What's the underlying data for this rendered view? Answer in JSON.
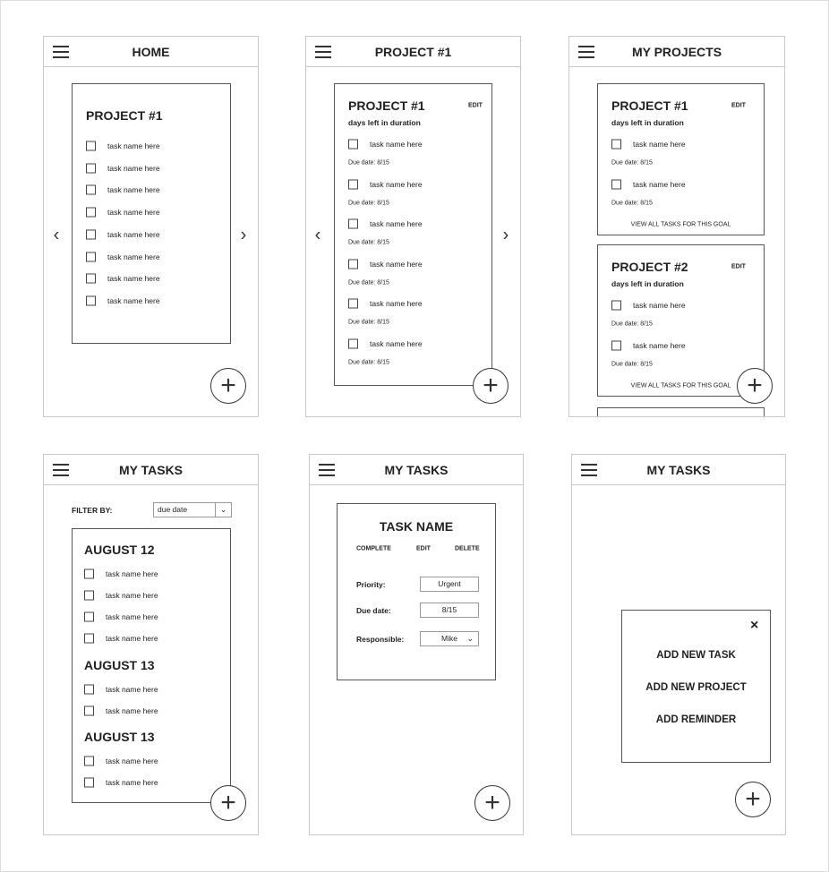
{
  "screens": [
    {
      "title": "HOME",
      "project": "PROJECT #1",
      "tasks": [
        "task name here",
        "task name here",
        "task name here",
        "task name here",
        "task name here",
        "task name here",
        "task name here",
        "task name here"
      ]
    },
    {
      "title": "PROJECT #1",
      "project": "PROJECT #1",
      "edit": "EDIT",
      "duration": "days left in duration",
      "tasks": [
        {
          "name": "task name here",
          "due": "Due date: 8/15"
        },
        {
          "name": "task name here",
          "due": "Due date: 8/15"
        },
        {
          "name": "task name here",
          "due": "Due date: 8/15"
        },
        {
          "name": "task name here",
          "due": "Due date: 8/15"
        },
        {
          "name": "task name here",
          "due": "Due date: 8/15"
        },
        {
          "name": "task name here",
          "due": "Due date: 8/15"
        }
      ]
    },
    {
      "title": "MY PROJECTS",
      "projects": [
        {
          "title": "PROJECT #1",
          "edit": "EDIT",
          "duration": "days left in duration",
          "tasks": [
            {
              "name": "task name here",
              "due": "Due date: 8/15"
            },
            {
              "name": "task name here",
              "due": "Due date: 8/15"
            }
          ],
          "view_all": "VIEW ALL TASKS FOR THIS GOAL"
        },
        {
          "title": "PROJECT #2",
          "edit": "EDIT",
          "duration": "days left in duration",
          "tasks": [
            {
              "name": "task name here",
              "due": "Due date: 8/15"
            },
            {
              "name": "task name here",
              "due": "Due date: 8/15"
            }
          ],
          "view_all": "VIEW ALL TASKS FOR THIS GOAL"
        }
      ]
    },
    {
      "title": "MY TASKS",
      "filter_label": "FILTER BY:",
      "filter_value": "due date",
      "groups": [
        {
          "heading": "AUGUST 12",
          "tasks": [
            "task name here",
            "task name here",
            "task name here",
            "task name here"
          ]
        },
        {
          "heading": "AUGUST 13",
          "tasks": [
            "task name here",
            "task name here"
          ]
        },
        {
          "heading": "AUGUST 13",
          "tasks": [
            "task name here",
            "task name here"
          ]
        }
      ]
    },
    {
      "title": "MY TASKS",
      "task_name": "TASK NAME",
      "actions": [
        "COMPLETE",
        "EDIT",
        "DELETE"
      ],
      "fields": [
        {
          "label": "Priority:",
          "value": "Urgent"
        },
        {
          "label": "Due date:",
          "value": "8/15"
        },
        {
          "label": "Responsible:",
          "value": "Mike"
        }
      ]
    },
    {
      "title": "MY TASKS",
      "menu": [
        "ADD NEW TASK",
        "ADD NEW PROJECT",
        "ADD REMINDER"
      ]
    }
  ],
  "icons": {
    "menu": "hamburger-icon",
    "prev": "chevron-left-icon",
    "next": "chevron-right-icon",
    "add": "plus-icon",
    "close": "close-icon",
    "dropdown": "chevron-down-icon"
  }
}
